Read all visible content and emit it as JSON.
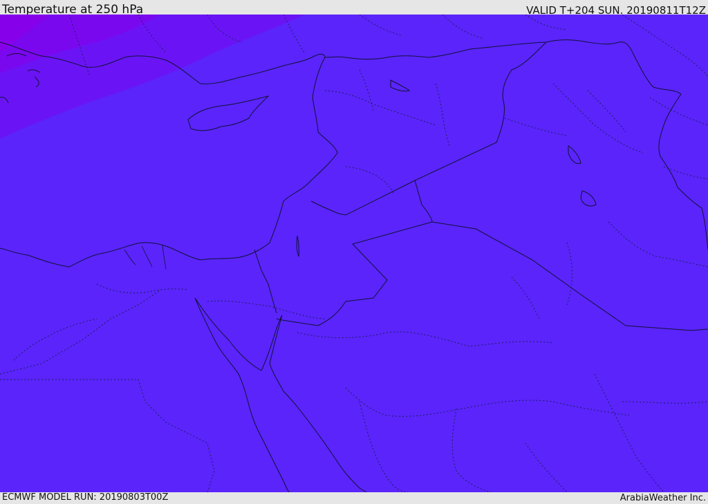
{
  "header": {
    "title": "Temperature at 250 hPa",
    "valid": "VALID T+204 SUN. 20190811T12Z"
  },
  "footer": {
    "model_run": "ECMWF MODEL RUN: 20190803T00Z",
    "credit": "ArabiaWeather Inc."
  },
  "map": {
    "field_colors": {
      "base": "#5a24fb",
      "band_mid": "#6a14f6",
      "band_warm": "#7a08ef",
      "band_hot": "#8600ea"
    },
    "coastline_color": "#111133",
    "border_color": "#111133"
  }
}
